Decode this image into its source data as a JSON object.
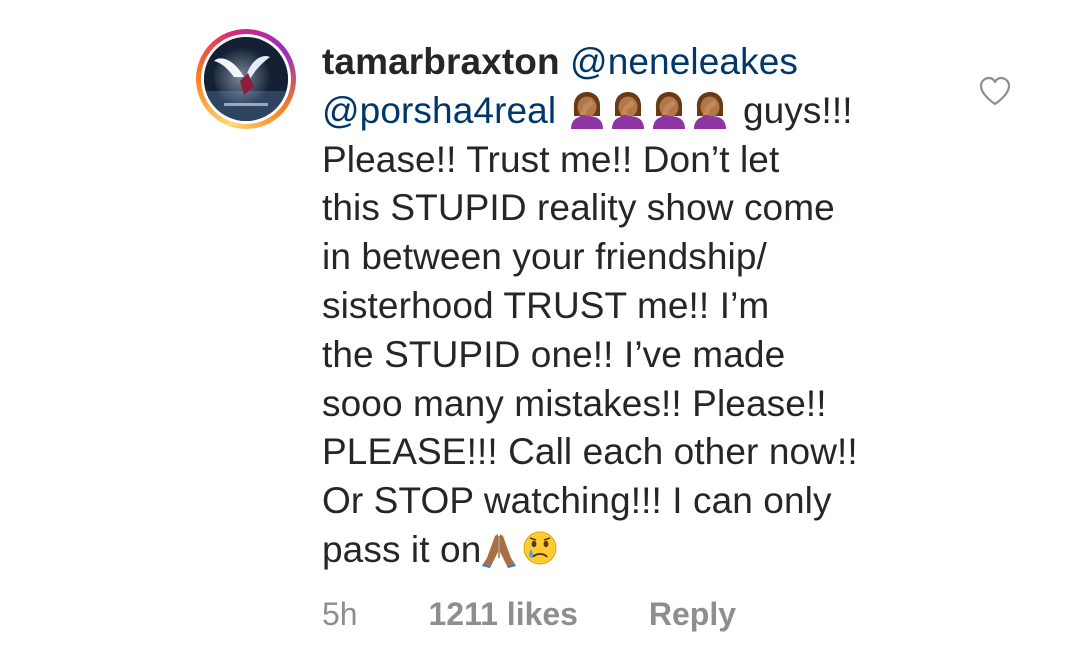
{
  "comment": {
    "username": "tamarbraxton",
    "mention_1": "@neneleakes",
    "mention_2": "@porsha4real",
    "facepalm_emoji_icon": "woman-facepalming-emoji",
    "after_emojis_text": "guys!!!",
    "lines": [
      "Please!! Trust me!! Don’t let",
      "this STUPID reality show come",
      "in between your friendship/",
      "sisterhood TRUST me!! I’m",
      "the STUPID one!! I’ve made",
      "sooo many mistakes!! Please!!",
      "PLEASE!!! Call each other now!!",
      "Or STOP watching!!! I can only"
    ],
    "last_line_text": "pass it on",
    "trailing_emojis": [
      "folded-hands-emoji",
      "crying-face-emoji"
    ]
  },
  "meta": {
    "time": "5h",
    "likes": "1211 likes",
    "reply": "Reply"
  },
  "icons": {
    "like": "heart-outline-icon"
  },
  "colors": {
    "text": "#262626",
    "mention": "#00376b",
    "meta": "#8e8e8e",
    "background": "#ffffff"
  }
}
